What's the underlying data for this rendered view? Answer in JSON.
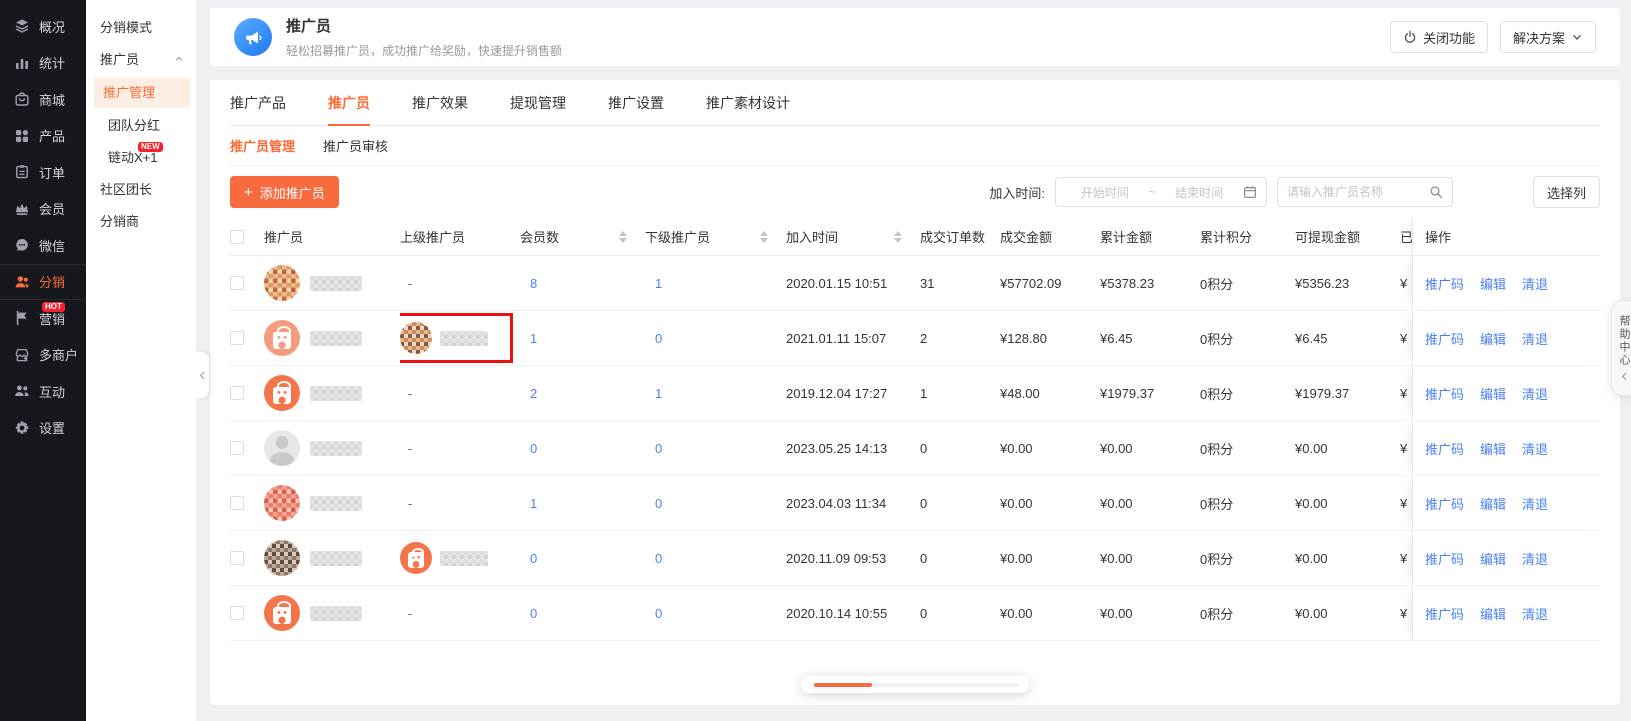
{
  "colors": {
    "accent": "#ff6a36",
    "button_orange": "#f76b3f",
    "link_blue": "#4a80f0",
    "badge_red": "#f5222d",
    "sidebar_dark": "#17181d"
  },
  "sidebar": {
    "items": [
      {
        "label": "概况",
        "icon": "layers-icon",
        "active": false,
        "badge": ""
      },
      {
        "label": "统计",
        "icon": "bar-chart-icon",
        "active": false,
        "badge": ""
      },
      {
        "label": "商城",
        "icon": "mall-icon",
        "active": false,
        "badge": ""
      },
      {
        "label": "产品",
        "icon": "grid-icon",
        "active": false,
        "badge": ""
      },
      {
        "label": "订单",
        "icon": "clipboard-icon",
        "active": false,
        "badge": ""
      },
      {
        "label": "会员",
        "icon": "crown-icon",
        "active": false,
        "badge": ""
      },
      {
        "label": "微信",
        "icon": "chat-icon",
        "active": false,
        "badge": ""
      },
      {
        "label": "分销",
        "icon": "person-icon",
        "active": true,
        "badge": ""
      },
      {
        "label": "营销",
        "icon": "flag-icon",
        "active": false,
        "badge": "HOT"
      },
      {
        "label": "多商户",
        "icon": "store-icon",
        "active": false,
        "badge": ""
      },
      {
        "label": "互动",
        "icon": "people-icon",
        "active": false,
        "badge": ""
      },
      {
        "label": "设置",
        "icon": "gear-icon",
        "active": false,
        "badge": ""
      }
    ]
  },
  "subsidebar": {
    "items": [
      {
        "label": "分销模式",
        "type": "top",
        "active": false,
        "badge": "",
        "caret": false
      },
      {
        "label": "推广员",
        "type": "top",
        "active": false,
        "badge": "",
        "caret": true
      },
      {
        "label": "推广管理",
        "type": "sub",
        "active": true,
        "badge": "",
        "caret": false
      },
      {
        "label": "团队分红",
        "type": "sub",
        "active": false,
        "badge": "",
        "caret": false
      },
      {
        "label": "链动X+1",
        "type": "sub",
        "active": false,
        "badge": "NEW",
        "caret": false
      },
      {
        "label": "社区团长",
        "type": "top",
        "active": false,
        "badge": "",
        "caret": false
      },
      {
        "label": "分销商",
        "type": "top",
        "active": false,
        "badge": "",
        "caret": false
      }
    ]
  },
  "page_header": {
    "title": "推广员",
    "subtitle": "轻松招募推广员，成功推广给奖励，快速提升销售额",
    "close_button": "关闭功能",
    "solution_button": "解决方案"
  },
  "tabs": {
    "items": [
      "推广产品",
      "推广员",
      "推广效果",
      "提现管理",
      "推广设置",
      "推广素材设计"
    ],
    "active": "推广员"
  },
  "subtabs": {
    "items": [
      "推广员管理",
      "推广员审核"
    ],
    "active": "推广员管理"
  },
  "toolbar": {
    "add_button": "添加推广员",
    "join_time_label": "加入时间:",
    "date_start_placeholder": "开始时间",
    "date_separator": "~",
    "date_end_placeholder": "结束时间",
    "search_placeholder": "请输入推广员名称",
    "select_columns_button": "选择列"
  },
  "table": {
    "columns": {
      "promoter": "推广员",
      "upline": "上级推广员",
      "members": "会员数",
      "downline": "下级推广员",
      "join_time": "加入时间",
      "order_count": "成交订单数",
      "deal_amount": "成交金额",
      "total_amount": "累计金额",
      "points": "累计积分",
      "withdrawable": "可提现金额",
      "clipped": "已",
      "ops": "操作"
    },
    "action_links": [
      "推广码",
      "编辑",
      "清退"
    ],
    "rows": [
      {
        "avatar": "girl",
        "upline": "-",
        "upline_avatar": "",
        "upline_boxed": false,
        "members": "8",
        "downline": "1",
        "join_time": "2020.01.15 10:51",
        "order_count": "31",
        "deal_amount": "¥57702.09",
        "total_amount": "¥5378.23",
        "points": "0积分",
        "withdrawable": "¥5356.23",
        "clipped": "¥"
      },
      {
        "avatar": "bag-light",
        "upline": "",
        "upline_avatar": "mosaic",
        "upline_boxed": true,
        "members": "1",
        "downline": "0",
        "join_time": "2021.01.11 15:07",
        "order_count": "2",
        "deal_amount": "¥128.80",
        "total_amount": "¥6.45",
        "points": "0积分",
        "withdrawable": "¥6.45",
        "clipped": "¥"
      },
      {
        "avatar": "bag",
        "upline": "-",
        "upline_avatar": "",
        "upline_boxed": false,
        "members": "2",
        "downline": "1",
        "join_time": "2019.12.04 17:27",
        "order_count": "1",
        "deal_amount": "¥48.00",
        "total_amount": "¥1979.37",
        "points": "0积分",
        "withdrawable": "¥1979.37",
        "clipped": "¥"
      },
      {
        "avatar": "gray",
        "upline": "-",
        "upline_avatar": "",
        "upline_boxed": false,
        "members": "0",
        "downline": "0",
        "join_time": "2023.05.25 14:13",
        "order_count": "0",
        "deal_amount": "¥0.00",
        "total_amount": "¥0.00",
        "points": "0积分",
        "withdrawable": "¥0.00",
        "clipped": "¥"
      },
      {
        "avatar": "red",
        "upline": "-",
        "upline_avatar": "",
        "upline_boxed": false,
        "members": "1",
        "downline": "0",
        "join_time": "2023.04.03 11:34",
        "order_count": "0",
        "deal_amount": "¥0.00",
        "total_amount": "¥0.00",
        "points": "0积分",
        "withdrawable": "¥0.00",
        "clipped": "¥"
      },
      {
        "avatar": "photo",
        "upline": "",
        "upline_avatar": "bag",
        "upline_boxed": false,
        "members": "0",
        "downline": "0",
        "join_time": "2020.11.09 09:53",
        "order_count": "0",
        "deal_amount": "¥0.00",
        "total_amount": "¥0.00",
        "points": "0积分",
        "withdrawable": "¥0.00",
        "clipped": "¥"
      },
      {
        "avatar": "bag",
        "upline": "-",
        "upline_avatar": "",
        "upline_boxed": false,
        "members": "0",
        "downline": "0",
        "join_time": "2020.10.14 10:55",
        "order_count": "0",
        "deal_amount": "¥0.00",
        "total_amount": "¥0.00",
        "points": "0积分",
        "withdrawable": "¥0.00",
        "clipped": "¥"
      }
    ]
  },
  "helper_tab": {
    "label": "帮助中心"
  }
}
